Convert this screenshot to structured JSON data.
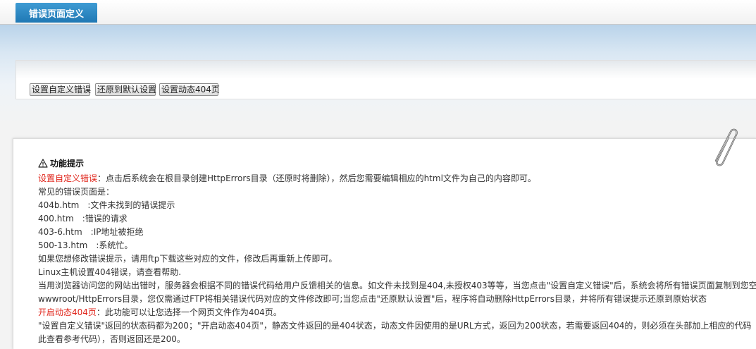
{
  "tab": {
    "label": "错误页面定义"
  },
  "toolbar": {
    "set_custom_error": "设置自定义错误",
    "restore_default": "还原到默认设置",
    "set_dynamic_404": "设置动态404页"
  },
  "info": {
    "title": "功能提示",
    "lines": [
      {
        "highlight": "设置自定义错误",
        "text": "：点击后系统会在根目录创建HttpErrors目录（还原时将删除），然后您需要编辑相应的html文件为自己的内容即可。"
      },
      {
        "highlight": "",
        "text": "常见的错误页面是："
      },
      {
        "highlight": "",
        "text": "404b.htm　:文件未找到的错误提示"
      },
      {
        "highlight": "",
        "text": "400.htm　:错误的请求"
      },
      {
        "highlight": "",
        "text": "403-6.htm　:IP地址被拒绝"
      },
      {
        "highlight": "",
        "text": "500-13.htm　:系统忙。"
      },
      {
        "highlight": "",
        "text": "如果您想修改错误提示，请用ftp下载这些对应的文件，修改后再重新上传即可。"
      },
      {
        "highlight": "",
        "text": "Linux主机设置404错误，请查看帮助."
      },
      {
        "highlight": "",
        "text": "当用浏览器访问您的网站出错时，服务器会根据不同的错误代码给用户反馈相关的信息。如文件未找到是404,未授权403等等，当您点击\"设置自定义错误\"后，系统会将所有错误页面复制到您空间的"
      },
      {
        "highlight": "",
        "text": "wwwroot/HttpErrors目录，您仅需通过FTP将相关错误代码对应的文件修改即可;当您点击\"还原默认设置\"后，程序将自动删除HttpErrors目录，并将所有错误提示还原到原始状态"
      },
      {
        "highlight": "开启动态404页",
        "text": "：此功能可以让您选择一个网页文件作为404页。"
      },
      {
        "highlight": "",
        "text": "\"设置自定义错误\"返回的状态码都为200；\"开启动态404页\"，静态文件返回的是404状态，动态文件因使用的是URL方式，返回为200状态，若需要返回404的，则必须在头部加上相应的代码（点"
      },
      {
        "highlight": "",
        "text": "此查看参考代码），否则返回还是200。"
      }
    ]
  },
  "colors": {
    "tab": "#2583c0",
    "highlight": "#e0251b"
  },
  "icons": {
    "warning": "warning-icon",
    "paperclip": "paperclip-icon"
  }
}
